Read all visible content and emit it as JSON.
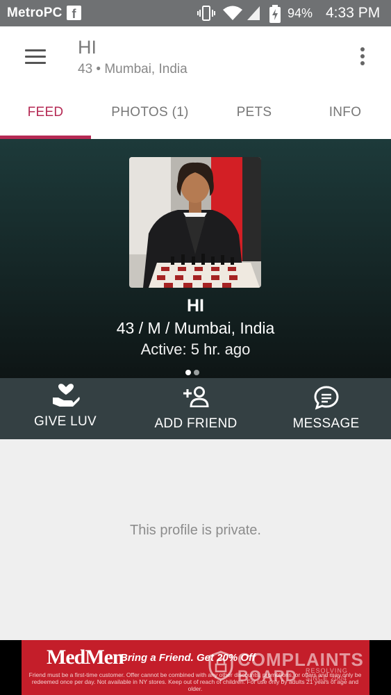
{
  "status_bar": {
    "carrier": "MetroPCS",
    "facebook_icon": "f",
    "battery_percent": "94%",
    "time": "4:33 PM"
  },
  "header": {
    "title": "HI",
    "subtitle": "43 • Mumbai, India"
  },
  "tabs": [
    {
      "label": "FEED"
    },
    {
      "label": "PHOTOS (1)"
    },
    {
      "label": "PETS"
    },
    {
      "label": "INFO"
    }
  ],
  "profile": {
    "name": "HI",
    "details": "43 / M / Mumbai, India",
    "active": "Active: 5 hr. ago"
  },
  "actions": [
    {
      "label": "GIVE LUV",
      "icon": "heart-hand-icon"
    },
    {
      "label": "ADD FRIEND",
      "icon": "add-person-icon"
    },
    {
      "label": "MESSAGE",
      "icon": "chat-bubble-icon"
    }
  ],
  "content": {
    "private_message": "This profile is private."
  },
  "ad": {
    "brand": "MedMen",
    "headline": "Bring a Friend.  Get 20% Off",
    "fine_print": "Friend must be a first-time customer. Offer cannot be combined with any other discounts, promotions, or offers and may only be redeemed once per day. Not available in NY stores. Keep out of reach of children. For use only by adults 21 years of age and older."
  },
  "watermark": {
    "line1": "COMPLAINTS",
    "line2": "BOARD",
    "line3a": "RESOLVING",
    "line3b": "SINCE 2004"
  },
  "colors": {
    "accent": "#b52a54",
    "status_bar": "#6f7173",
    "action_bar": "#344043",
    "ad_red": "#c41e2a"
  }
}
